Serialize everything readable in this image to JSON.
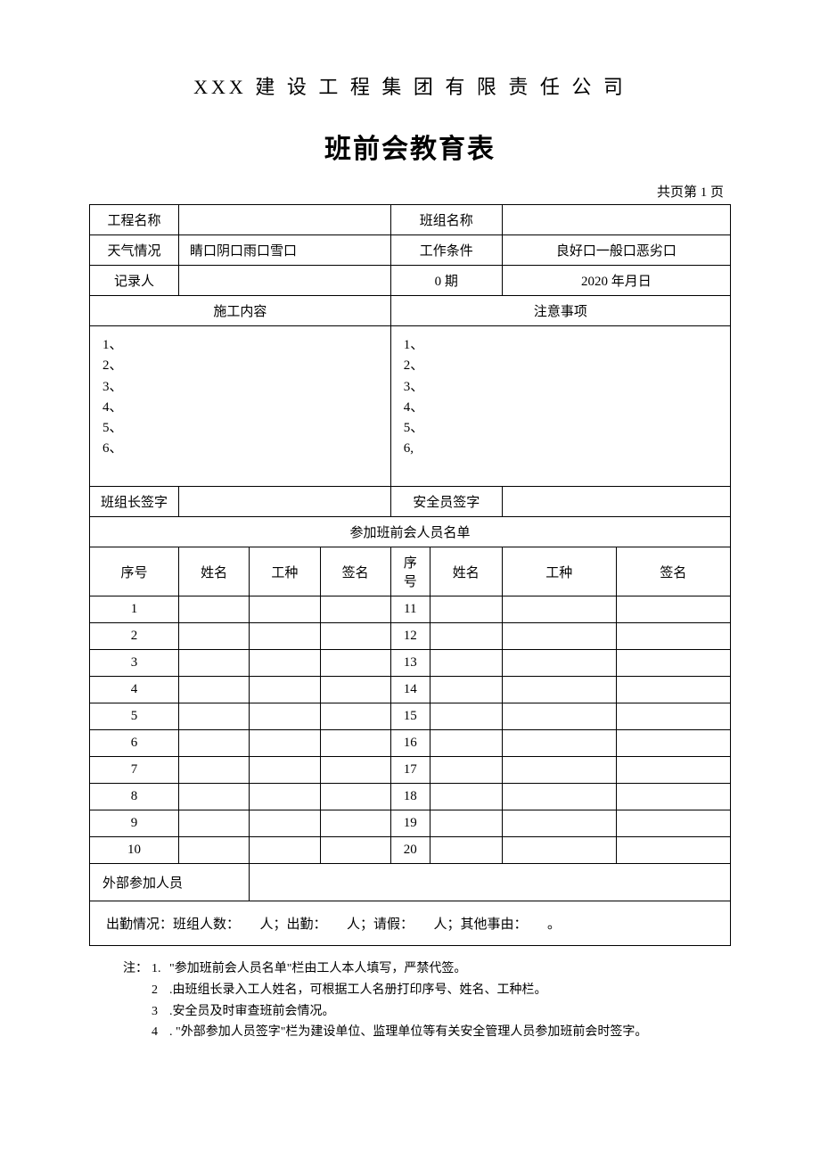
{
  "header": {
    "company": "XXX 建 设 工 程 集 团 有 限 责 任 公 司",
    "title": "班前会教育表",
    "page_info": "共页第 1 页"
  },
  "fields": {
    "project_name_label": "工程名称",
    "project_name_value": "",
    "team_name_label": "班组名称",
    "team_name_value": "",
    "weather_label": "天气情况",
    "weather_value": "睛口阴口雨口雪口",
    "work_cond_label": "工作条件",
    "work_cond_value": "良好口一般口恶劣口",
    "recorder_label": "记录人",
    "recorder_value": "",
    "date_label": "0 期",
    "date_value": "2020 年月日",
    "construction_header": "施工内容",
    "precautions_header": "注意事项",
    "construction_items": "1、\n2、\n3、\n4、\n5、\n6、",
    "precaution_items": "1、\n2、\n3、\n4、\n5、\n6,",
    "leader_sign_label": "班组长签字",
    "leader_sign_value": "",
    "safety_sign_label": "安全员签字",
    "safety_sign_value": ""
  },
  "roster": {
    "title": "参加班前会人员名单",
    "cols": {
      "seq": "序号",
      "name": "姓名",
      "worktype": "工种",
      "sign": "签名"
    },
    "left_nums": [
      "1",
      "2",
      "3",
      "4",
      "5",
      "6",
      "7",
      "8",
      "9",
      "10"
    ],
    "right_nums": [
      "11",
      "12",
      "13",
      "14",
      "15",
      "16",
      "17",
      "18",
      "19",
      "20"
    ],
    "external_label": "外部参加人员",
    "attendance_text": "出勤情况：班组人数：　　人；出勤：　　人；请假：　　人；其他事由：　　。"
  },
  "notes": {
    "prefix": "注：",
    "n1_num": "1.",
    "n1": "\"参加班前会人员名单\"栏由工人本人填写，严禁代签。",
    "n2_num": "2",
    "n2": " .由班组长录入工人姓名，可根据工人名册打印序号、姓名、工种栏。",
    "n3_num": "3",
    "n3": " .安全员及时审查班前会情况。",
    "n4_num": "4",
    "n4": " . \"外部参加人员签字\"栏为建设单位、监理单位等有关安全管理人员参加班前会时签字。"
  }
}
